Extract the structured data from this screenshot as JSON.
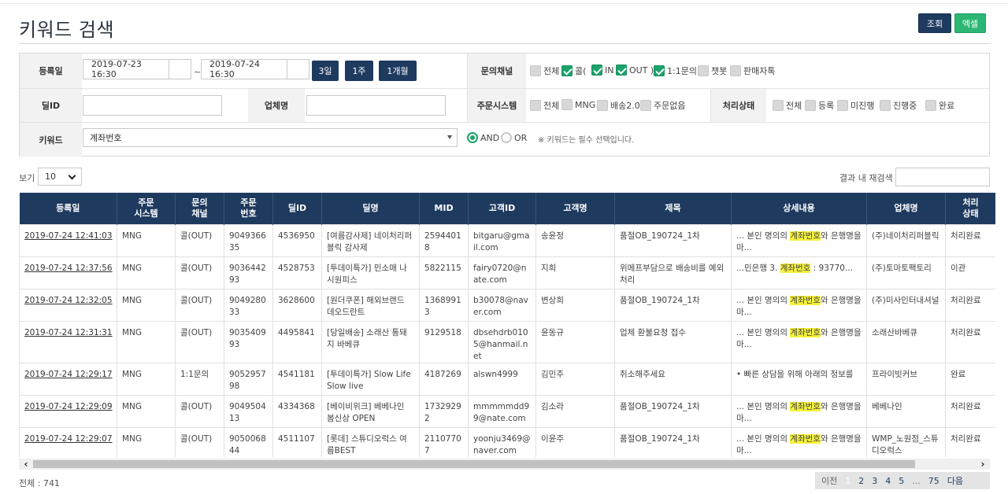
{
  "title": "키워드 검색",
  "buttons": {
    "search": "조회",
    "excel": "엑셀"
  },
  "filter": {
    "reg_label": "등록일",
    "date_from": "2019-07-23 16:30",
    "date_to": "2019-07-24 16:30",
    "range_sep": "~",
    "quick": [
      "3일",
      "1주",
      "1개월"
    ],
    "channel_label": "문의채널",
    "channels": [
      {
        "label": "전체",
        "checked": false
      },
      {
        "label": "콜(",
        "checked": true
      },
      {
        "label": "IN",
        "checked": true
      },
      {
        "label": "OUT )",
        "checked": true
      },
      {
        "label": "1:1문의",
        "checked": true
      },
      {
        "label": "챗봇",
        "checked": false
      },
      {
        "label": "판매자톡",
        "checked": false
      }
    ],
    "deal_label": "딜ID",
    "company_label": "업체명",
    "order_sys_label": "주문시스템",
    "order_systems": [
      {
        "label": "전체",
        "checked": false
      },
      {
        "label": "MNG",
        "checked": false
      },
      {
        "label": "배송2.0",
        "checked": false
      },
      {
        "label": "주문없음",
        "checked": false
      }
    ],
    "status_label": "처리상태",
    "statuses": [
      {
        "label": "전체",
        "checked": false
      },
      {
        "label": "등록",
        "checked": false
      },
      {
        "label": "미진행",
        "checked": false
      },
      {
        "label": "진행중",
        "checked": false
      },
      {
        "label": "완료",
        "checked": false
      }
    ],
    "keyword_label": "키워드",
    "keyword_value": "계좌번호",
    "and_label": "AND",
    "or_label": "OR",
    "note": "※ 키워드는 필수 선택입니다."
  },
  "list": {
    "view_label": "보기",
    "view_value": "10",
    "research_label": "결과 내 재검색",
    "total": "전체 : 741"
  },
  "table": {
    "headers": [
      "등록일",
      "주문\n시스템",
      "문의\n채널",
      "주문\n번호",
      "딜ID",
      "딜명",
      "MID",
      "고객ID",
      "고객명",
      "제목",
      "상세내용",
      "업체명",
      "처리\n상태"
    ],
    "rows": [
      {
        "date": "2019-07-24 12:41:03",
        "sys": "MNG",
        "ch": "콜(OUT)",
        "ord": "904936635",
        "deal": "4536950",
        "dname": "[여름감사제] 네이처리퍼블릭 감사제",
        "mid": "25944018",
        "cid": "bitgaru@gmail.com",
        "cname": "송윤정",
        "subj": "품절OB_190724_1차",
        "d1": "... 본인 명의의 ",
        "dk": "계좌번호",
        "d2": "와 은행명을 마...",
        "comp": "(주)네이처리퍼블릭",
        "st": "처리완료"
      },
      {
        "date": "2019-07-24 12:37:56",
        "sys": "MNG",
        "ch": "콜(OUT)",
        "ord": "903644293",
        "deal": "4528753",
        "dname": "[투데이특가] 민소매 나시원피스",
        "mid": "5822115",
        "cid": "fairy0720@nate.com",
        "cname": "지희",
        "subj": "위메프부담으로 배송비를 예외처리",
        "d1": "...민은행 3. ",
        "dk": "계좌번호",
        "d2": " : 93770...",
        "comp": "(주)토마토팩토리",
        "st": "이관"
      },
      {
        "date": "2019-07-24 12:32:05",
        "sys": "MNG",
        "ch": "콜(OUT)",
        "ord": "904928033",
        "deal": "3628600",
        "dname": "[원더쿠폰] 해외브랜드 데오드란트",
        "mid": "13689913",
        "cid": "b30078@naver.com",
        "cname": "변상희",
        "subj": "품절OB_190724_1차",
        "d1": "... 본인 명의의 ",
        "dk": "계좌번호",
        "d2": "와 은행명을 마...",
        "comp": "(주)미사인터내셔널",
        "st": "처리완료"
      },
      {
        "date": "2019-07-24 12:31:31",
        "sys": "MNG",
        "ch": "콜(OUT)",
        "ord": "903540993",
        "deal": "4495841",
        "dname": "[당일배송] 소래산 통돼지 바베큐",
        "mid": "9129518",
        "cid": "dbsehdrb0105@hanmail.net",
        "cname": "윤동규",
        "subj": "업체 환불요청 접수",
        "d1": "... 본인 명의의 ",
        "dk": "계좌번호",
        "d2": "와 은행명을 마...",
        "comp": "소래산바베큐",
        "st": "처리완료"
      },
      {
        "date": "2019-07-24 12:29:17",
        "sys": "MNG",
        "ch": "1:1문의",
        "ord": "905295798",
        "deal": "4541181",
        "dname": "[투데이특가] Slow Life Slow live",
        "mid": "4187269",
        "cid": "alswn4999",
        "cname": "김민주",
        "subj": "취소해주세요",
        "d1": "• 빠른 상담을 위해 아래의 정보를",
        "dk": "",
        "d2": "",
        "comp": "프라이빗커브",
        "st": "완료"
      },
      {
        "date": "2019-07-24 12:29:09",
        "sys": "MNG",
        "ch": "콜(OUT)",
        "ord": "904950413",
        "deal": "4334368",
        "dname": "[베이비위크] 베베나인 봄신상 OPEN",
        "mid": "17329292",
        "cid": "mmmmmdd99@nate.com",
        "cname": "김소라",
        "subj": "품절OB_190724_1차",
        "d1": "... 본인 명의의 ",
        "dk": "계좌번호",
        "d2": "와 은행명을 마...",
        "comp": "베베나인",
        "st": "처리완료"
      },
      {
        "date": "2019-07-24 12:29:07",
        "sys": "MNG",
        "ch": "콜(OUT)",
        "ord": "905006844",
        "deal": "4511107",
        "dname": "[롯데] 스튜디오럭스 여름BEST",
        "mid": "21107707",
        "cid": "yoonju3469@naver.com",
        "cname": "이윤주",
        "subj": "품절OB_190724_1차",
        "d1": "... 본인 명의의 ",
        "dk": "계좌번호",
        "d2": "와 은행명을 마...",
        "comp": "WMP_노원점_스튜디오럭스",
        "st": "처리완료"
      }
    ]
  },
  "pager": {
    "prev": "이전",
    "pages": [
      "1",
      "2",
      "3",
      "4",
      "5"
    ],
    "ellipsis": "...",
    "last": "75",
    "next": "다음"
  },
  "colors": {
    "header": "#1e3a5f",
    "accent_green": "#1aa36b",
    "excel": "#2bb673",
    "highlight": "#f5f23a"
  }
}
